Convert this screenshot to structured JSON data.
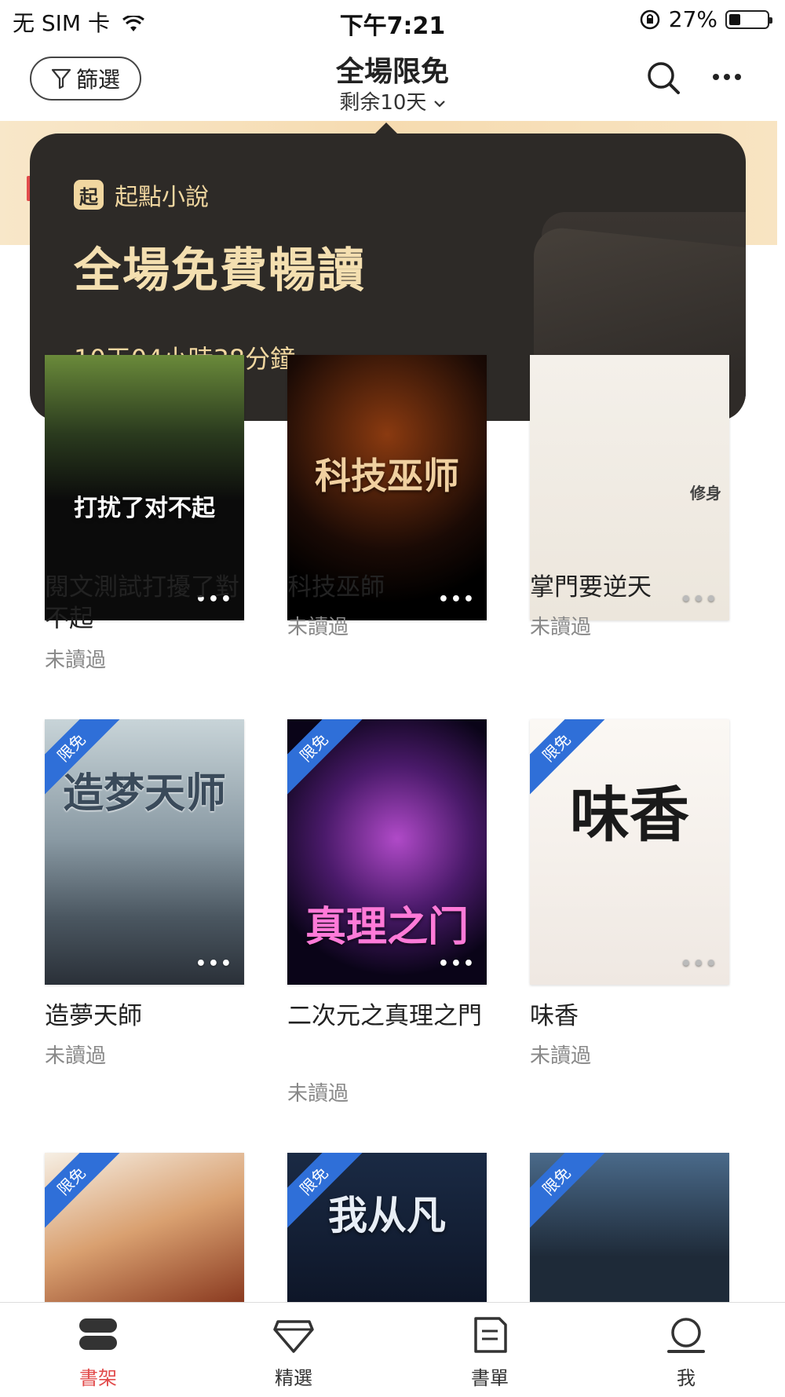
{
  "status_bar": {
    "carrier": "无 SIM 卡",
    "time": "下午7:21",
    "battery": "27%"
  },
  "nav": {
    "filter_label": "篩選",
    "title": "全場限免",
    "subtitle": "剩余10天"
  },
  "popup": {
    "brand": "起點小說",
    "brand_logo": "起",
    "headline": "全場免費暢讀",
    "countdown": "10天04小時38分鐘"
  },
  "books": [
    {
      "title": "閱文測試打擾了對不起",
      "status": "未讀過",
      "cover_text": "打扰了对不起",
      "badge": ""
    },
    {
      "title": "科技巫師",
      "status": "未讀過",
      "cover_text": "科技巫师",
      "badge": ""
    },
    {
      "title": "掌門要逆天",
      "status": "未讀過",
      "cover_text": "修身",
      "badge": ""
    },
    {
      "title": "造夢天師",
      "status": "未讀過",
      "cover_text": "造梦天师",
      "badge": "限免"
    },
    {
      "title": "二次元之真理之門",
      "status": "未讀過",
      "cover_text": "真理之门",
      "badge": "限免"
    },
    {
      "title": "味香",
      "status": "未讀過",
      "cover_text": "味香",
      "badge": "限免"
    },
    {
      "title": "",
      "status": "",
      "cover_text": "",
      "badge": "限免"
    },
    {
      "title": "",
      "status": "",
      "cover_text": "我从凡",
      "badge": "限免"
    },
    {
      "title": "",
      "status": "",
      "cover_text": "",
      "badge": "限免"
    }
  ],
  "tabs": [
    {
      "label": "書架",
      "icon": "bookshelf-icon",
      "active": true
    },
    {
      "label": "精選",
      "icon": "diamond-icon",
      "active": false
    },
    {
      "label": "書單",
      "icon": "booklist-icon",
      "active": false
    },
    {
      "label": "我",
      "icon": "profile-icon",
      "active": false
    }
  ],
  "colors": {
    "accent": "#e24b4b",
    "badge": "#2f6fd8",
    "popup_bg": "#2d2a27",
    "popup_text": "#f1d7a0"
  }
}
